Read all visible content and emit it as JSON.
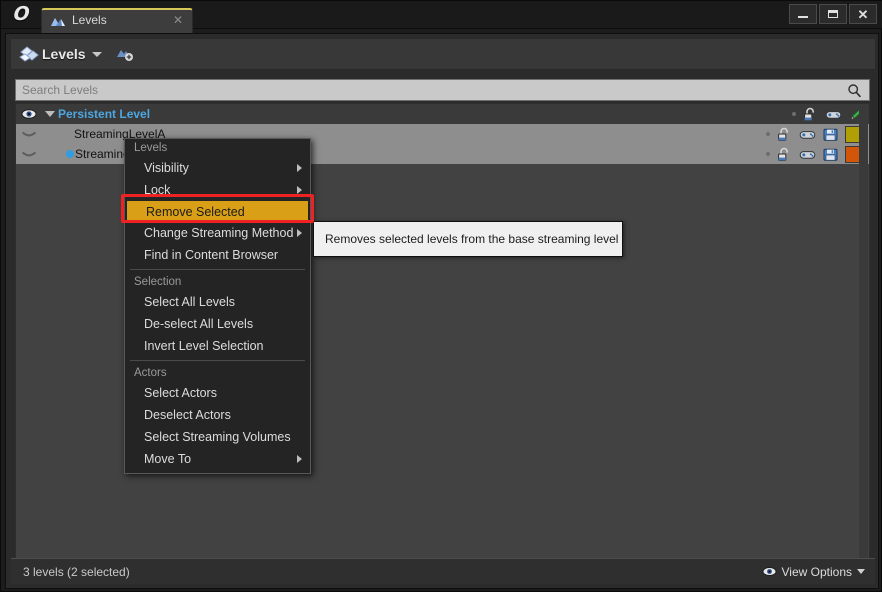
{
  "window": {
    "app_logo": "unreal-engine-logo",
    "buttons": {
      "minimize": "–",
      "maximize": "□",
      "close": "✕"
    }
  },
  "tab": {
    "label": "Levels",
    "icon": "levels-mountain-icon",
    "close": "✕"
  },
  "toolbar": {
    "title": "Levels",
    "icon": "levels-stack-icon",
    "dropdown_caret": "chevron-down-icon",
    "add_level_icon": "add-level-icon"
  },
  "search": {
    "placeholder": "Search Levels",
    "value": "",
    "icon": "search-icon"
  },
  "list": {
    "rows": [
      {
        "name": "Persistent Level",
        "type": "persistent",
        "selected": false,
        "eye_icon": "eye-visible-icon",
        "expander": "expanded-triangle-icon",
        "lock_icon": "lock-open-icon",
        "gamepad_icon": "gamepad-icon",
        "edit_icon": "pencil-green-icon",
        "swatch": ""
      },
      {
        "name": "StreamingLevelA",
        "type": "streaming",
        "selected": true,
        "eye_icon": "eye-closed-icon",
        "lock_icon": "lock-open-icon",
        "gamepad_icon": "gamepad-icon",
        "save_icon": "save-floppy-icon",
        "swatch": "#b0a006"
      },
      {
        "name": "StreamingLevelB",
        "type": "streaming",
        "selected": true,
        "current_marker": true,
        "eye_icon": "eye-closed-icon",
        "lock_icon": "lock-open-icon",
        "gamepad_icon": "gamepad-icon",
        "save_icon": "save-floppy-icon",
        "swatch": "#d2560a"
      }
    ]
  },
  "context_menu": {
    "title": "Levels",
    "sections": [
      {
        "header": "",
        "items": [
          {
            "label": "Visibility",
            "submenu": true
          },
          {
            "label": "Lock",
            "submenu": true
          },
          {
            "label": "Remove Selected",
            "submenu": false,
            "highlighted": true
          },
          {
            "label": "Change Streaming Method",
            "submenu": true
          },
          {
            "label": "Find in Content Browser",
            "submenu": false
          }
        ]
      },
      {
        "header": "Selection",
        "items": [
          {
            "label": "Select All Levels",
            "submenu": false
          },
          {
            "label": "De-select All Levels",
            "submenu": false
          },
          {
            "label": "Invert Level Selection",
            "submenu": false
          }
        ]
      },
      {
        "header": "Actors",
        "items": [
          {
            "label": "Select Actors",
            "submenu": false
          },
          {
            "label": "Deselect Actors",
            "submenu": false
          },
          {
            "label": "Select Streaming Volumes",
            "submenu": false
          },
          {
            "label": "Move To",
            "submenu": true
          }
        ]
      }
    ]
  },
  "tooltip": {
    "text": "Removes selected levels from the base streaming level"
  },
  "status": {
    "text": "3 levels (2 selected)",
    "view_options_label": "View Options",
    "view_options_icon": "eye-icon"
  },
  "colors": {
    "highlight": "#d9a017",
    "annotation_ring": "#ee2222",
    "persistent_level_text": "#4da6e0",
    "selection_row": "#8e8e8e"
  }
}
